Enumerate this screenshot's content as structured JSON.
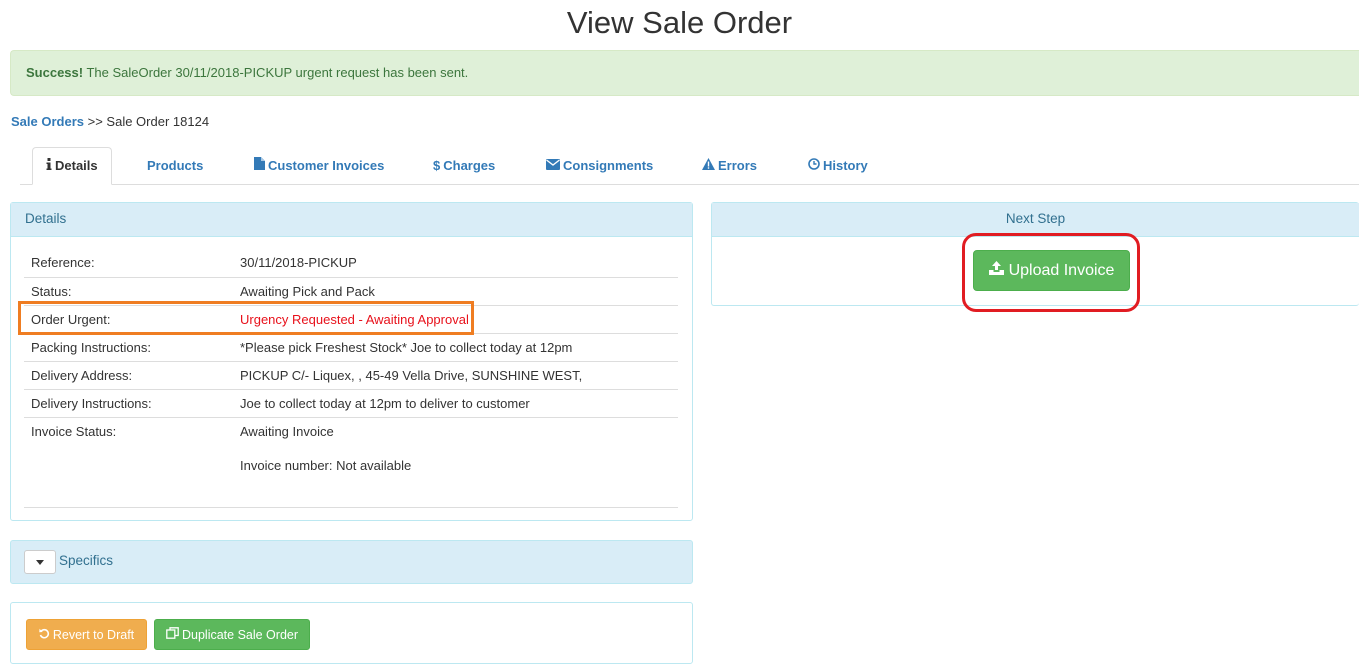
{
  "page": {
    "title": "View Sale Order"
  },
  "alert": {
    "strong": "Success!",
    "message": " The SaleOrder 30/11/2018-PICKUP urgent request has been sent."
  },
  "breadcrumb": {
    "link": "Sale Orders",
    "separator": " >> ",
    "current": "Sale Order 18124"
  },
  "tabs": [
    {
      "label": "Details",
      "icon": "info-icon",
      "active": true
    },
    {
      "label": "Products",
      "icon": "",
      "active": false
    },
    {
      "label": "Customer Invoices",
      "icon": "file-icon",
      "active": false
    },
    {
      "label": "Charges",
      "icon": "dollar-icon",
      "active": false
    },
    {
      "label": "Consignments",
      "icon": "envelope-icon",
      "active": false
    },
    {
      "label": "Errors",
      "icon": "warning-icon",
      "active": false
    },
    {
      "label": "History",
      "icon": "clock-icon",
      "active": false
    }
  ],
  "details": {
    "heading": "Details",
    "rows": [
      {
        "label": "Reference:",
        "value": "30/11/2018-PICKUP"
      },
      {
        "label": "Status:",
        "value": "Awaiting Pick and Pack"
      },
      {
        "label": "Order Urgent:",
        "value": "Urgency Requested - Awaiting Approval"
      },
      {
        "label": "Packing Instructions:",
        "value": "*Please pick Freshest Stock* Joe to collect today at 12pm"
      },
      {
        "label": "Delivery Address:",
        "value": "PICKUP C/- Liquex, , 45-49 Vella Drive, SUNSHINE WEST,"
      },
      {
        "label": "Delivery Instructions:",
        "value": "Joe to collect today at 12pm to deliver to customer"
      },
      {
        "label": "Invoice Status:",
        "value": "Awaiting Invoice",
        "value2": "Invoice number: Not available"
      }
    ]
  },
  "next_step": {
    "heading": "Next Step",
    "button": "Upload Invoice",
    "icon": "upload-icon"
  },
  "specifics": {
    "label": "Specifics",
    "icon": "caret-down-icon"
  },
  "actions": {
    "revert": {
      "label": "Revert to Draft",
      "icon": "undo-icon"
    },
    "duplicate": {
      "label": "Duplicate Sale Order",
      "icon": "copy-icon"
    }
  },
  "colors": {
    "link": "#337ab7",
    "success_bg": "#dff0d8",
    "success_text": "#3c763d",
    "panel_heading_bg": "#d9edf7",
    "urgent_text": "#e8111b",
    "btn_success": "#5cb85c",
    "btn_warning": "#f0ad4e",
    "highlight_orange": "#ef7d22",
    "highlight_red": "#e11c22"
  }
}
